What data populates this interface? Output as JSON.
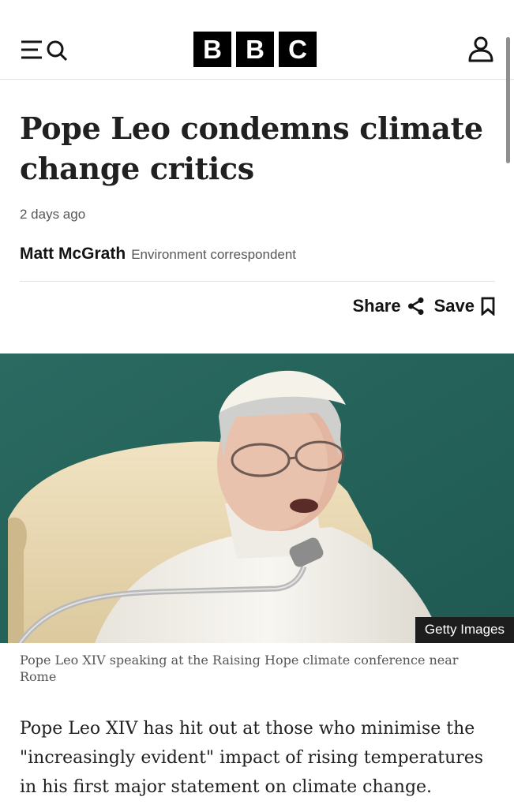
{
  "header": {
    "logo_letters": [
      "B",
      "B",
      "C"
    ],
    "icons": {
      "menu": "menu-icon",
      "search": "search-icon",
      "account": "account-icon"
    }
  },
  "article": {
    "headline": "Pope Leo condemns climate change critics",
    "timestamp": "2 days ago",
    "author": "Matt McGrath",
    "role": "Environment correspondent",
    "share_label": "Share",
    "save_label": "Save",
    "image_credit": "Getty Images",
    "caption": "Pope Leo XIV speaking at the Raising Hope climate conference near Rome",
    "first_paragraph": "Pope Leo XIV has hit out at those who minimise the \"increasingly evident\" impact of rising temperatures in his first major statement on climate change."
  },
  "colors": {
    "brand": "#000000",
    "text": "#141414",
    "muted": "#545658",
    "divider": "#e0e0e0"
  }
}
